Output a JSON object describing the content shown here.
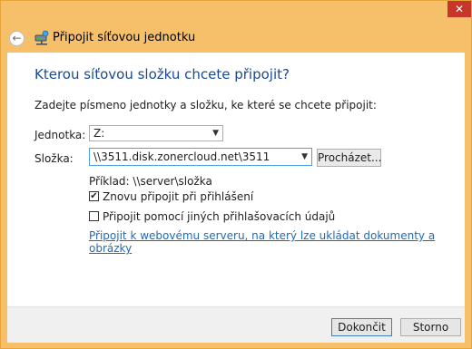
{
  "titlebar": {
    "title": "Připojit síťovou jednotku",
    "close_glyph": "✕",
    "back_glyph": "←"
  },
  "main": {
    "heading": "Kterou síťovou složku chcete připojit?",
    "instruction": "Zadejte písmeno jednotky a složku, ke které se chcete připojit:",
    "drive_label": "Jednotka:",
    "drive_value": "Z:",
    "folder_label": "Složka:",
    "folder_value": "\\\\3511.disk.zonercloud.net\\3511",
    "browse_label": "Procházet...",
    "example": "Příklad: \\\\server\\složka",
    "reconnect_label": "Znovu připojit při přihlášení",
    "reconnect_checked": true,
    "other_creds_label": "Připojit pomocí jiných přihlašovacích údajů",
    "other_creds_checked": false,
    "web_link": "Připojit k webovému serveru, na který lze ukládat dokumenty a obrázky"
  },
  "footer": {
    "finish_label": "Dokončit",
    "cancel_label": "Storno"
  },
  "colors": {
    "title_accent": "#f6c06a",
    "heading": "#1b4a92",
    "link": "#1c6bbe",
    "close": "#c7362b"
  },
  "icons": [
    "close-icon",
    "back-arrow-icon",
    "network-drive-icon",
    "chevron-down-icon",
    "checkmark-icon"
  ]
}
